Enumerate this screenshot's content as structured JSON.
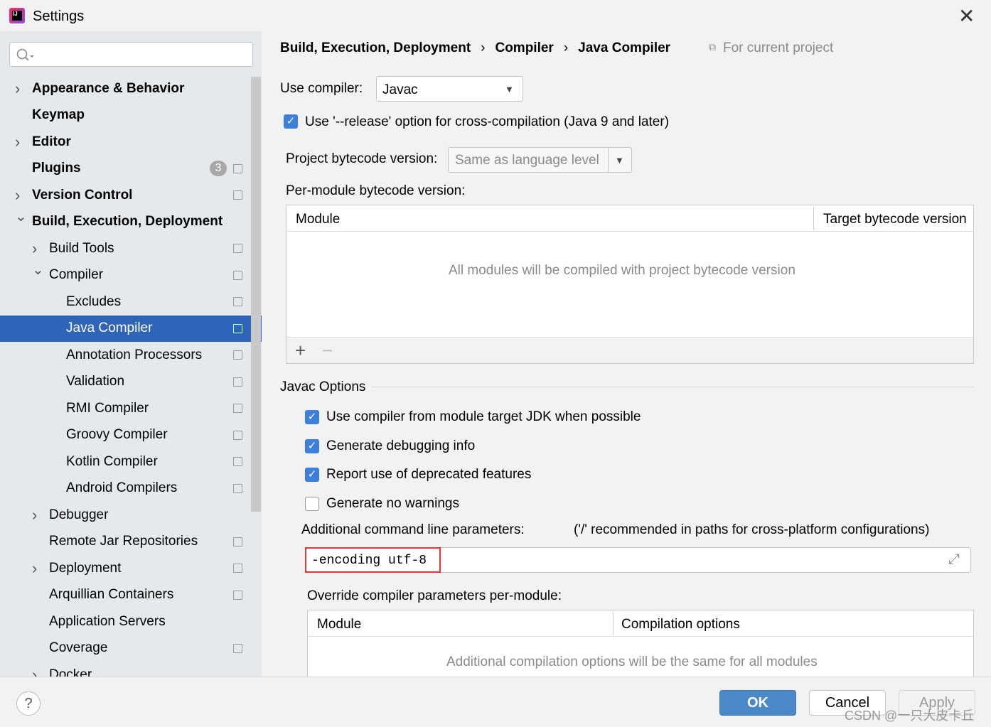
{
  "window": {
    "title": "Settings",
    "close_icon": "close-icon",
    "app_icon": "intellij-logo-icon"
  },
  "search": {
    "placeholder": "",
    "value": ""
  },
  "sidebar": {
    "items": [
      {
        "label": "Appearance & Behavior",
        "level": 0,
        "bold": true,
        "chevron": "right",
        "copy": false
      },
      {
        "label": "Keymap",
        "level": 0,
        "bold": true,
        "chevron": "",
        "copy": false
      },
      {
        "label": "Editor",
        "level": 0,
        "bold": true,
        "chevron": "right",
        "copy": false
      },
      {
        "label": "Plugins",
        "level": 0,
        "bold": true,
        "chevron": "",
        "copy": true,
        "badge": "3"
      },
      {
        "label": "Version Control",
        "level": 0,
        "bold": true,
        "chevron": "right",
        "copy": true
      },
      {
        "label": "Build, Execution, Deployment",
        "level": 0,
        "bold": true,
        "chevron": "down",
        "copy": false
      },
      {
        "label": "Build Tools",
        "level": 1,
        "chevron": "right",
        "copy": true
      },
      {
        "label": "Compiler",
        "level": 1,
        "chevron": "down",
        "copy": true
      },
      {
        "label": "Excludes",
        "level": 2,
        "chevron": "",
        "copy": true
      },
      {
        "label": "Java Compiler",
        "level": 2,
        "chevron": "",
        "copy": true,
        "selected": true
      },
      {
        "label": "Annotation Processors",
        "level": 2,
        "chevron": "",
        "copy": true
      },
      {
        "label": "Validation",
        "level": 2,
        "chevron": "",
        "copy": true
      },
      {
        "label": "RMI Compiler",
        "level": 2,
        "chevron": "",
        "copy": true
      },
      {
        "label": "Groovy Compiler",
        "level": 2,
        "chevron": "",
        "copy": true
      },
      {
        "label": "Kotlin Compiler",
        "level": 2,
        "chevron": "",
        "copy": true
      },
      {
        "label": "Android Compilers",
        "level": 2,
        "chevron": "",
        "copy": true
      },
      {
        "label": "Debugger",
        "level": 1,
        "chevron": "right",
        "copy": false
      },
      {
        "label": "Remote Jar Repositories",
        "level": 1,
        "chevron": "",
        "copy": true
      },
      {
        "label": "Deployment",
        "level": 1,
        "chevron": "right",
        "copy": true
      },
      {
        "label": "Arquillian Containers",
        "level": 1,
        "chevron": "",
        "copy": true
      },
      {
        "label": "Application Servers",
        "level": 1,
        "chevron": "",
        "copy": false
      },
      {
        "label": "Coverage",
        "level": 1,
        "chevron": "",
        "copy": true
      },
      {
        "label": "Docker",
        "level": 1,
        "chevron": "right",
        "copy": false
      }
    ]
  },
  "breadcrumb": {
    "items": [
      "Build, Execution, Deployment",
      "Compiler",
      "Java Compiler"
    ],
    "scope": "For current project"
  },
  "compiler": {
    "label": "Use compiler:",
    "value": "Javac"
  },
  "release_option": {
    "label": "Use '--release' option for cross-compilation (Java 9 and later)",
    "checked": true
  },
  "bytecode": {
    "label": "Project bytecode version:",
    "value": "Same as language level"
  },
  "per_module": {
    "label": "Per-module bytecode version:",
    "columns": [
      "Module",
      "Target bytecode version"
    ],
    "empty_text": "All modules will be compiled with project bytecode version",
    "add": "+",
    "remove": "−"
  },
  "javac": {
    "section_title": "Javac Options",
    "options": [
      {
        "label": "Use compiler from module target JDK when possible",
        "checked": true
      },
      {
        "label": "Generate debugging info",
        "checked": true
      },
      {
        "label": "Report use of deprecated features",
        "checked": true
      },
      {
        "label": "Generate no warnings",
        "checked": false
      }
    ],
    "params_label": "Additional command line parameters:",
    "params_hint": "('/' recommended in paths for cross-platform configurations)",
    "params_value": "-encoding utf-8",
    "override_label": "Override compiler parameters per-module:",
    "override_columns": [
      "Module",
      "Compilation options"
    ],
    "override_empty": "Additional compilation options will be the same for all modules"
  },
  "footer": {
    "help": "?",
    "ok": "OK",
    "cancel": "Cancel",
    "apply": "Apply",
    "watermark": "CSDN @一只大皮卡丘"
  },
  "colors": {
    "accent": "#3d7fdc",
    "selection": "#2f65b9",
    "highlight_box": "#e53935"
  }
}
